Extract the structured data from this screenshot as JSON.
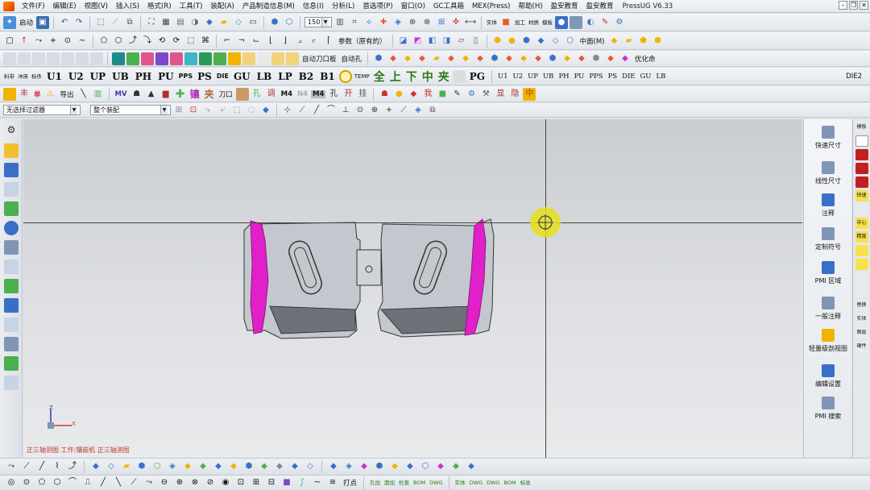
{
  "app": {
    "title": "PressUG V6.33"
  },
  "menu": [
    "文件(F)",
    "编辑(E)",
    "视图(V)",
    "插入(S)",
    "格式(R)",
    "工具(T)",
    "装配(A)",
    "产品制造信息(M)",
    "信息(I)",
    "分析(L)",
    "首选项(P)",
    "窗口(O)",
    "GC工具箱",
    "MEX(Press)",
    "帮助(H)",
    "盈安教育",
    "盈安教育"
  ],
  "toolbar1": {
    "start_label": "启动",
    "zoom_value": "150",
    "labels": [
      "实体",
      "加工",
      "材质",
      "模板"
    ]
  },
  "toolbar2": {
    "param_label": "参数（原有的）",
    "mid_label": "中面(M)"
  },
  "toolbar3": {
    "labels": [
      "自动刀口板",
      "自动孔"
    ],
    "optimize_label": "优化命"
  },
  "toolbar4": {
    "prefix": [
      "料带",
      "冲床",
      "标件"
    ],
    "codes": [
      "U1",
      "U2",
      "UP",
      "UB",
      "PH",
      "PU",
      "PPS",
      "PS",
      "DIE",
      "GU",
      "LB",
      "LP",
      "B2",
      "B1"
    ],
    "temp_label": "TEMP",
    "cjk": [
      "全",
      "上",
      "下",
      "中",
      "夹"
    ],
    "pg_label": "PG",
    "right_codes": [
      "U1",
      "U2",
      "UP",
      "UB",
      "PH",
      "PU",
      "PPS",
      "PS",
      "DIE",
      "GU",
      "LB"
    ],
    "die2": "DIE2"
  },
  "toolbar5": {
    "labels": [
      "单",
      "导出",
      "MV",
      "镶",
      "夹",
      "刀口",
      "M4",
      "N4",
      "M4"
    ]
  },
  "toolbar6": {
    "filter": "无选择过滤器",
    "assembly": "整个装配"
  },
  "viewport": {
    "view_label": "正三轴测图 工作:镶嵌机 正三轴测图",
    "axis_x": "X",
    "axis_z": "Z",
    "axis_y": "Y"
  },
  "right_panel": [
    {
      "label": "快速尺寸",
      "icon": "quick-dimension-icon"
    },
    {
      "label": "线性尺寸",
      "icon": "linear-dimension-icon"
    },
    {
      "label": "注释",
      "icon": "note-icon"
    },
    {
      "label": "定制符号",
      "icon": "custom-symbol-icon"
    },
    {
      "label": "PMI 区域",
      "icon": "pmi-region-icon"
    },
    {
      "label": "一般注释",
      "icon": "general-note-icon"
    },
    {
      "label": "轻量级剖视图",
      "icon": "section-view-icon"
    },
    {
      "label": "编辑设置",
      "icon": "edit-settings-icon"
    },
    {
      "label": "PMI 搜索",
      "icon": "pmi-search-icon"
    }
  ],
  "far_right": [
    "模板",
    "快速",
    "中心",
    "精度",
    "替换",
    "实体",
    "图层",
    "硬件"
  ],
  "bottom1": {
    "labels": [
      "打点"
    ]
  },
  "bottom2": {
    "labels": [
      "孔加",
      "面加",
      "检查",
      "BOM",
      "DWG",
      "实体",
      "DWG",
      "DWG",
      "BOM",
      "标准"
    ]
  },
  "colors": {
    "accent_magenta": "#e020c8",
    "part_gray": "#c4c8ce",
    "cursor_yellow": "#e8df1c"
  }
}
